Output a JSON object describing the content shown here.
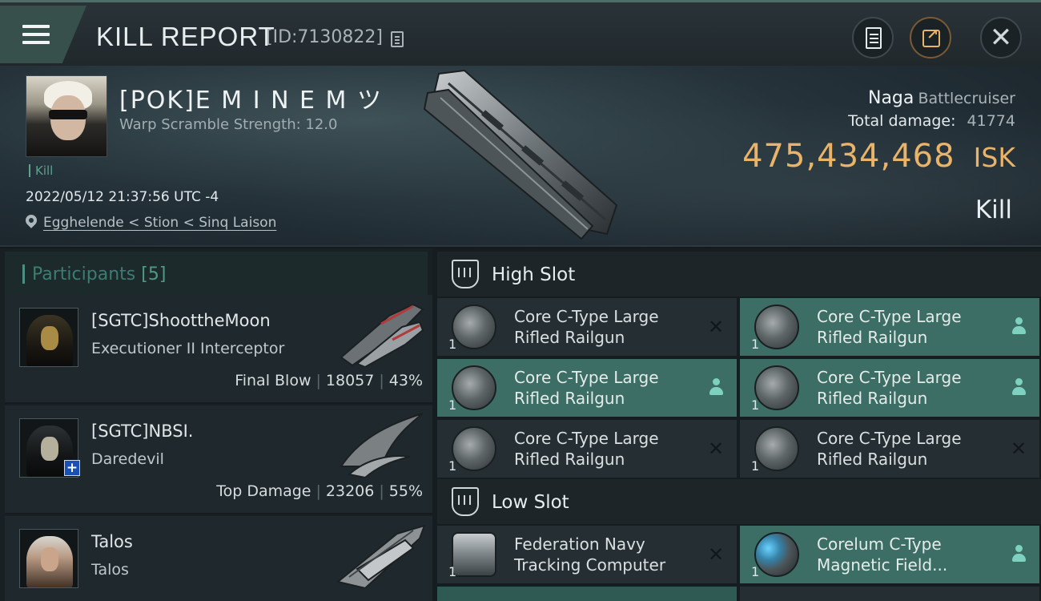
{
  "header": {
    "title": "KILL REPORT",
    "report_id": "[ID:7130822]"
  },
  "icons": {
    "menu": "hamburger-icon",
    "copy": "copy-icon",
    "clipboard": "clipboard-icon",
    "share": "share-icon",
    "close": "close-icon",
    "location": "map-pin-icon",
    "slot": "slot-icon",
    "lost": "x-icon",
    "fitted": "person-icon"
  },
  "victim": {
    "name": "[POK]E M I N E M ツ",
    "subtitle": "Warp Scramble Strength: 12.0",
    "tag": "Kill",
    "datetime": "2022/05/12 21:37:56 UTC -4",
    "location": "Egghelende < Stion < Sinq Laison",
    "ship_name": "Naga",
    "ship_class": "Battlecruiser",
    "total_damage_label": "Total damage:",
    "total_damage": "41774",
    "isk_value": "475,434,468",
    "isk_unit": "ISK",
    "result": "Kill"
  },
  "participants": {
    "title": "Participants",
    "count": "[5]",
    "items": [
      {
        "name": "[SGTC]ShoottheMoon",
        "ship": "Executioner II Interceptor",
        "role": "Final Blow",
        "damage": "18057",
        "percent": "43%"
      },
      {
        "name": "[SGTC]NBSI.",
        "ship": "Daredevil",
        "role": "Top Damage",
        "damage": "23206",
        "percent": "55%"
      },
      {
        "name": "Talos",
        "ship": "Talos",
        "role": "",
        "damage": "",
        "percent": ""
      }
    ]
  },
  "slots": {
    "high": {
      "title": "High Slot",
      "items": [
        {
          "name": "Core C-Type Large Rifled Railgun",
          "qty": "1",
          "status": "destroyed"
        },
        {
          "name": "Core C-Type Large Rifled Railgun",
          "qty": "1",
          "status": "dropped"
        },
        {
          "name": "Core C-Type Large Rifled Railgun",
          "qty": "1",
          "status": "dropped"
        },
        {
          "name": "Core C-Type Large Rifled Railgun",
          "qty": "1",
          "status": "dropped"
        },
        {
          "name": "Core C-Type Large Rifled Railgun",
          "qty": "1",
          "status": "destroyed"
        },
        {
          "name": "Core C-Type Large Rifled Railgun",
          "qty": "1",
          "status": "destroyed"
        }
      ]
    },
    "low": {
      "title": "Low Slot",
      "items": [
        {
          "name": "Federation Navy Tracking Computer",
          "qty": "1",
          "status": "destroyed"
        },
        {
          "name": "Corelum C-Type Magnetic Field...",
          "qty": "1",
          "status": "dropped"
        }
      ]
    }
  },
  "colors": {
    "accent_teal": "#3d6e66",
    "isk_gold": "#e9b46a",
    "panel_dark": "#182024"
  }
}
